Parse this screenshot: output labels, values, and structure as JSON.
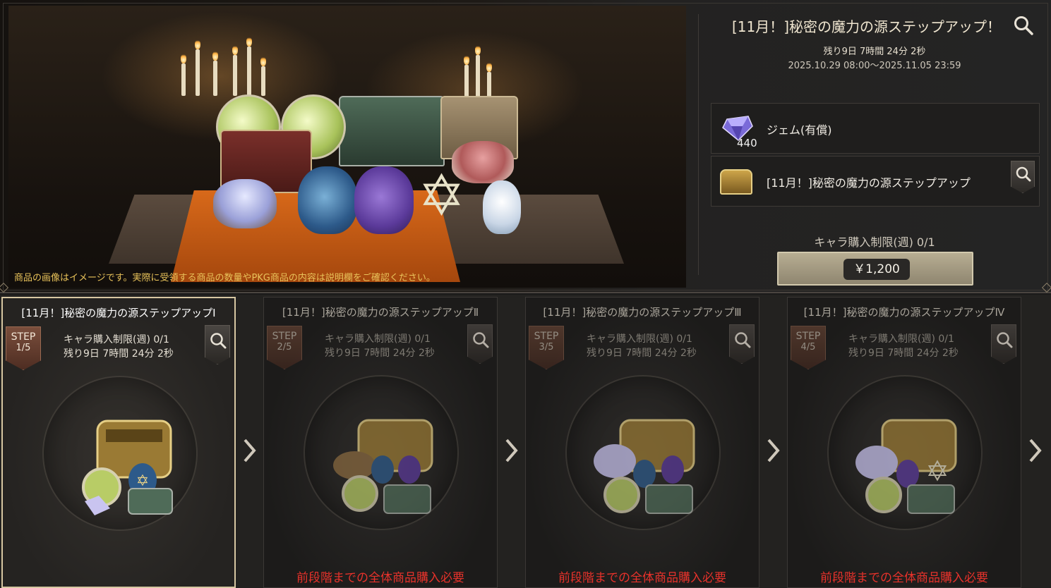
{
  "header": {
    "title": "[11月！]秘密の魔力の源ステップアップ！",
    "remaining": "残り9日 7時間 24分 2秒",
    "period": "2025.10.29 08:00～2025.11.05 23:59"
  },
  "banner": {
    "image_note": "商品の画像はイメージです。実際に受領する商品の数量やPKG商品の内容は説明欄をご確認ください。"
  },
  "contents": [
    {
      "name": "ジェム(有償)",
      "quantity": "440",
      "icon": "gem-icon"
    },
    {
      "name": "[11月！]秘密の魔力の源ステップアップ",
      "quantity": "",
      "icon": "treasure-chest-icon"
    }
  ],
  "purchase": {
    "limit": "キャラ購入制限(週) 0/1",
    "price": "￥1,200"
  },
  "steps": [
    {
      "title": "[11月！]秘密の魔力の源ステップアップⅠ",
      "step_label": "STEP",
      "step_num": "1/5",
      "limit": "キャラ購入制限(週) 0/1",
      "remaining": "残り9日 7時間 24分 2秒",
      "requirement": "",
      "state": "active"
    },
    {
      "title": "[11月！]秘密の魔力の源ステップアップⅡ",
      "step_label": "STEP",
      "step_num": "2/5",
      "limit": "キャラ購入制限(週) 0/1",
      "remaining": "残り9日 7時間 24分 2秒",
      "requirement": "前段階までの全体商品購入必要",
      "state": "locked"
    },
    {
      "title": "[11月！]秘密の魔力の源ステップアップⅢ",
      "step_label": "STEP",
      "step_num": "3/5",
      "limit": "キャラ購入制限(週) 0/1",
      "remaining": "残り9日 7時間 24分 2秒",
      "requirement": "前段階までの全体商品購入必要",
      "state": "locked"
    },
    {
      "title": "[11月！]秘密の魔力の源ステップアップⅣ",
      "step_label": "STEP",
      "step_num": "4/5",
      "limit": "キャラ購入制限(週) 0/1",
      "remaining": "残り9日 7時間 24分 2秒",
      "requirement": "前段階までの全体商品購入必要",
      "state": "locked"
    }
  ],
  "colors": {
    "accent_gold": "#e8c25a",
    "warning_red": "#e8322b",
    "price_button": "#b7ad92",
    "step_badge": "#7a4e3c"
  },
  "icons": [
    "search-icon",
    "gem-icon",
    "treasure-chest-icon",
    "chevron-right-icon"
  ]
}
